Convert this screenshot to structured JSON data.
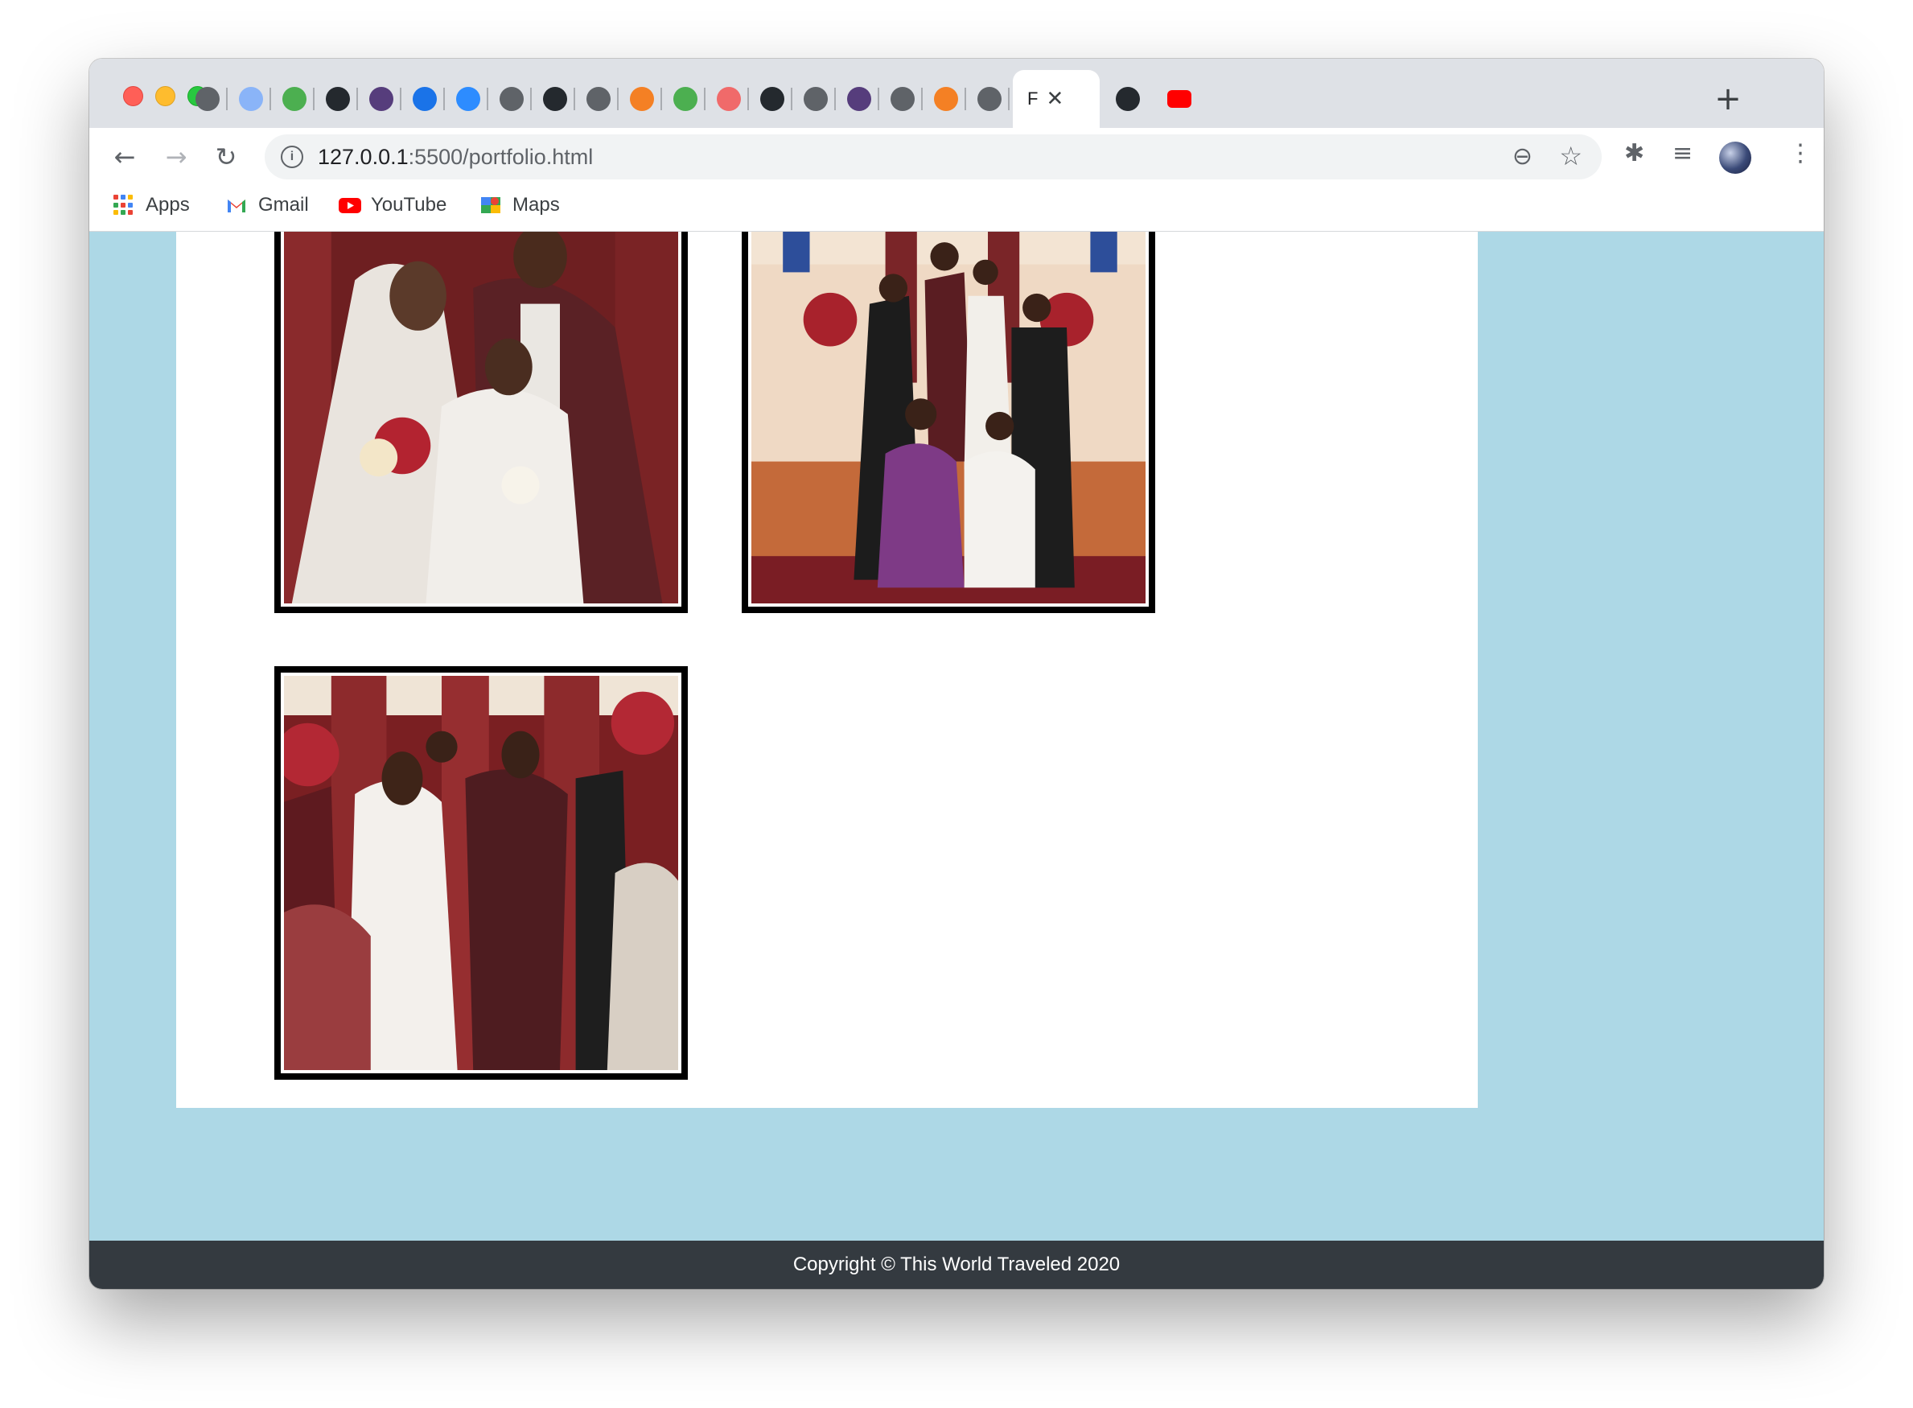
{
  "browser": {
    "tabs": [
      {
        "icon": "globe-icon",
        "color": "#5f6368"
      },
      {
        "icon": "document-icon",
        "color": "#8ab4f8"
      },
      {
        "icon": "w3schools-icon",
        "color": "#4caf50"
      },
      {
        "icon": "github-icon",
        "color": "#24292e"
      },
      {
        "icon": "bootstrap-icon",
        "color": "#563d7c"
      },
      {
        "icon": "refresh-circle-icon",
        "color": "#1a73e8"
      },
      {
        "icon": "zoom-icon",
        "color": "#2d8cff"
      },
      {
        "icon": "globe-icon",
        "color": "#5f6368"
      },
      {
        "icon": "github-icon",
        "color": "#24292e"
      },
      {
        "icon": "globe-icon",
        "color": "#5f6368"
      },
      {
        "icon": "stackoverflow-icon",
        "color": "#f48024"
      },
      {
        "icon": "w3schools-icon",
        "color": "#4caf50"
      },
      {
        "icon": "asana-icon",
        "color": "#f06a6a"
      },
      {
        "icon": "github-icon",
        "color": "#24292e"
      },
      {
        "icon": "globe-icon",
        "color": "#5f6368"
      },
      {
        "icon": "bootstrap-icon",
        "color": "#563d7c"
      },
      {
        "icon": "globe-icon",
        "color": "#5f6368"
      },
      {
        "icon": "stackoverflow-icon",
        "color": "#f48024"
      },
      {
        "icon": "globe-icon",
        "color": "#5f6368"
      }
    ],
    "active_tab": {
      "label": "F",
      "close": "✕"
    },
    "after_tabs": [
      {
        "icon": "github-icon",
        "color": "#24292e"
      },
      {
        "icon": "youtube-icon",
        "color": "#ff0000"
      }
    ],
    "new_tab": "+",
    "url_host": "127.0.0.1",
    "url_path": ":5500/portfolio.html",
    "bookmarks": [
      {
        "label": "Apps",
        "icon": "apps-grid-icon"
      },
      {
        "label": "Gmail",
        "icon": "gmail-icon"
      },
      {
        "label": "YouTube",
        "icon": "youtube-icon"
      },
      {
        "label": "Maps",
        "icon": "maps-icon"
      }
    ]
  },
  "page": {
    "background": "#add8e6",
    "photos": [
      {
        "alt": "bride-groom-flower-girl"
      },
      {
        "alt": "wedding-party-family"
      },
      {
        "alt": "bride-groom-dancing"
      }
    ],
    "footer": "Copyright © This World Traveled 2020"
  }
}
